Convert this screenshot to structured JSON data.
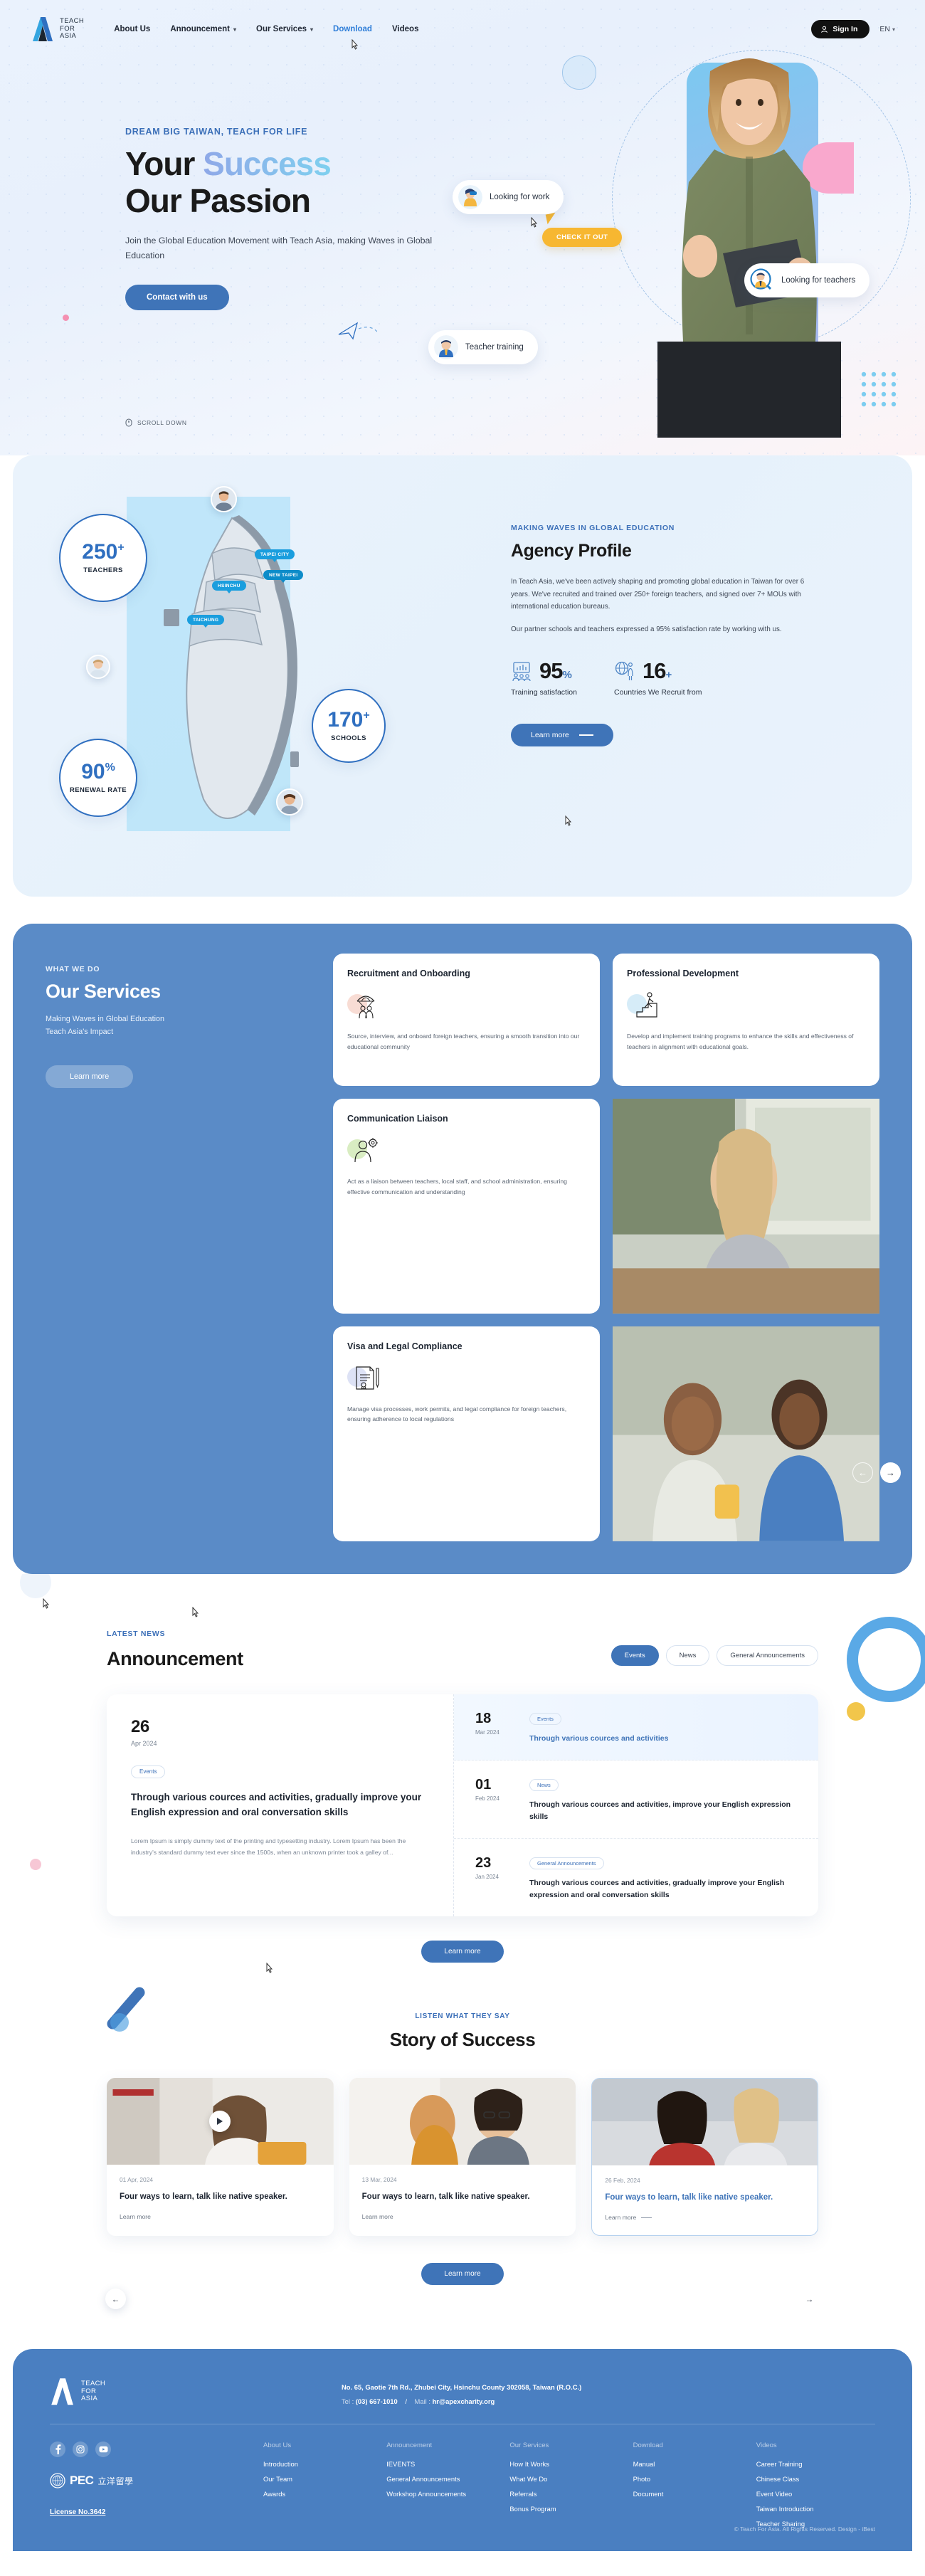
{
  "header": {
    "brand": {
      "line1": "TEACH",
      "line2": "FOR",
      "line3": "ASIA",
      "logo_icon": "teach-for-asia-logo"
    },
    "nav": [
      {
        "label": "About Us",
        "has_caret": false,
        "active": false
      },
      {
        "label": "Announcement",
        "has_caret": true,
        "active": false
      },
      {
        "label": "Our Services",
        "has_caret": true,
        "active": false
      },
      {
        "label": "Download",
        "has_caret": false,
        "active": true
      },
      {
        "label": "Videos",
        "has_caret": false,
        "active": false
      }
    ],
    "sign_in": "Sign In",
    "lang": "EN"
  },
  "hero": {
    "eyebrow": "DREAM BIG TAIWAN, TEACH FOR LIFE",
    "title_line1_plain": "Your ",
    "title_line1_accent": "Success",
    "title_line2": "Our Passion",
    "subtitle": "Join the Global Education Movement with Teach Asia, making Waves in Global Education",
    "cta": "Contact with us",
    "scroll": "SCROLL DOWN",
    "badges": {
      "looking_for_work": "Looking for work",
      "check_it_out": "CHECK IT OUT",
      "teacher_training": "Teacher training",
      "looking_for_teachers": "Looking for teachers"
    }
  },
  "profile": {
    "eyebrow": "MAKING WAVES IN GLOBAL EDUCATION",
    "title": "Agency Profile",
    "para1": "In Teach Asia, we've been actively shaping and promoting global education in Taiwan for over 6 years. We've recruited and trained over 250+ foreign teachers, and signed over 7+ MOUs with international education bureaus.",
    "para2": "Our partner schools and teachers expressed a 95% satisfaction rate by working with us.",
    "stats": [
      {
        "value": "95",
        "suffix": "%",
        "caption": "Training satisfaction",
        "icon": "presentation-chart-icon"
      },
      {
        "value": "16",
        "suffix": "+",
        "caption": "Countries We Recruit from",
        "icon": "globe-person-icon"
      }
    ],
    "cta": "Learn more",
    "map_circles": [
      {
        "number": "250",
        "sup": "+",
        "label": "TEACHERS"
      },
      {
        "number": "170",
        "sup": "+",
        "label": "SCHOOLS"
      },
      {
        "number": "90",
        "sup": "%",
        "label": "RENEWAL RATE"
      }
    ],
    "map_tags": [
      "TAIPEI CITY",
      "NEW TAIPEI",
      "HSINCHU",
      "TAICHUNG"
    ]
  },
  "services": {
    "eyebrow": "WHAT WE DO",
    "title": "Our Services",
    "sub_line1": "Making Waves in Global Education",
    "sub_line2": "Teach Asia's Impact",
    "cta": "Learn more",
    "cards": [
      {
        "title": "Recruitment and Onboarding",
        "body": "Source, interview, and onboard foreign teachers, ensuring a smooth transition into our educational community",
        "icon": "parachute-people-icon",
        "blob": "#f8dcd4"
      },
      {
        "title": "Professional Development",
        "body": "Develop and implement training programs to enhance the skills and effectiveness of teachers in alignment with educational goals.",
        "icon": "person-stairs-icon",
        "blob": "#d6ecf8"
      },
      {
        "title": "Communication Liaison",
        "body": "Act as a liaison between teachers, local staff, and school administration, ensuring effective communication and understanding",
        "icon": "person-gear-icon",
        "blob": "#d9edc2"
      },
      {
        "title": "Visa and Legal Compliance",
        "body": "Manage visa processes, work permits, and legal compliance for foreign teachers, ensuring adherence to local regulations",
        "icon": "document-seal-icon",
        "blob": "#dde2f5"
      }
    ]
  },
  "announcement": {
    "eyebrow": "LATEST NEWS",
    "title": "Announcement",
    "tabs": [
      {
        "label": "Events",
        "active": true
      },
      {
        "label": "News",
        "active": false
      },
      {
        "label": "General Announcements",
        "active": false
      }
    ],
    "feature": {
      "day": "26",
      "month": "Apr 2024",
      "tag": "Events",
      "title": "Through various cources and activities, gradually improve your English expression and oral conversation skills",
      "excerpt": "Lorem Ipsum is simply dummy text of the printing and typesetting industry. Lorem Ipsum has been the industry's standard dummy text ever since the 1500s, when an unknown printer took a galley of..."
    },
    "list": [
      {
        "day": "18",
        "month": "Mar 2024",
        "tag": "Events",
        "title": "Through various cources and activities",
        "highlight": true
      },
      {
        "day": "01",
        "month": "Feb 2024",
        "tag": "News",
        "title": "Through various cources and activities, improve your English expression skills",
        "highlight": false
      },
      {
        "day": "23",
        "month": "Jan 2024",
        "tag": "General Announcements",
        "title": "Through various cources and activities, gradually improve your English expression and oral conversation skills",
        "highlight": false
      }
    ],
    "cta": "Learn more"
  },
  "stories": {
    "eyebrow": "LISTEN WHAT THEY SAY",
    "title": "Story of Success",
    "cards": [
      {
        "date": "01 Apr, 2024",
        "title": "Four ways to learn, talk like native speaker.",
        "more": "Learn more",
        "has_play": true,
        "active": false
      },
      {
        "date": "13 Mar, 2024",
        "title": "Four ways to learn, talk like native speaker.",
        "more": "Learn more",
        "has_play": false,
        "active": false
      },
      {
        "date": "26 Feb, 2024",
        "title": "Four ways to learn, talk like native speaker.",
        "more": "Learn more",
        "has_play": false,
        "active": true
      }
    ],
    "cta": "Learn more"
  },
  "footer": {
    "brand": {
      "line1": "TEACH",
      "line2": "FOR",
      "line3": "ASIA"
    },
    "address": "No. 65, Gaotie 7th Rd., Zhubei City, Hsinchu County 302058, Taiwan (R.O.C.)",
    "tel_label": "Tel :",
    "tel_value": "(03) 667-1010",
    "sep": "/",
    "mail_label": "Mail :",
    "mail_value": "hr@apexcharity.org",
    "social": [
      {
        "name": "facebook-icon",
        "glyph": "f"
      },
      {
        "name": "instagram-icon",
        "glyph": "◻"
      },
      {
        "name": "youtube-icon",
        "glyph": "▶"
      }
    ],
    "partner": {
      "abbr": "PEC",
      "cn": "立洋留學"
    },
    "columns": [
      {
        "heading": "About Us",
        "links": [
          "Introduction",
          "Our Team",
          "Awards"
        ]
      },
      {
        "heading": "Announcement",
        "links": [
          "IEVENTS",
          "General Announcements",
          "Workshop Announcements"
        ]
      },
      {
        "heading": "Our Services",
        "links": [
          "How It Works",
          "What We Do",
          "Referrals",
          "Bonus Program"
        ]
      },
      {
        "heading": "Download",
        "links": [
          "Manual",
          "Photo",
          "Document"
        ]
      },
      {
        "heading": "Videos",
        "links": [
          "Career Training",
          "Chinese Class",
          "Event Video",
          "Taiwan Introduction",
          "Teacher Sharing"
        ]
      }
    ],
    "license": "License No.3642",
    "copyright": "© Teach For Asia. All Rights Reserved. Design - iBest"
  },
  "colors": {
    "brand_blue": "#3f74b8",
    "accent_light_blue": "#7fd0ef",
    "services_bg": "#5a8bc7",
    "footer_bg": "#4a7fc1",
    "yellow": "#f7b731",
    "pink": "#f9a8cd"
  }
}
